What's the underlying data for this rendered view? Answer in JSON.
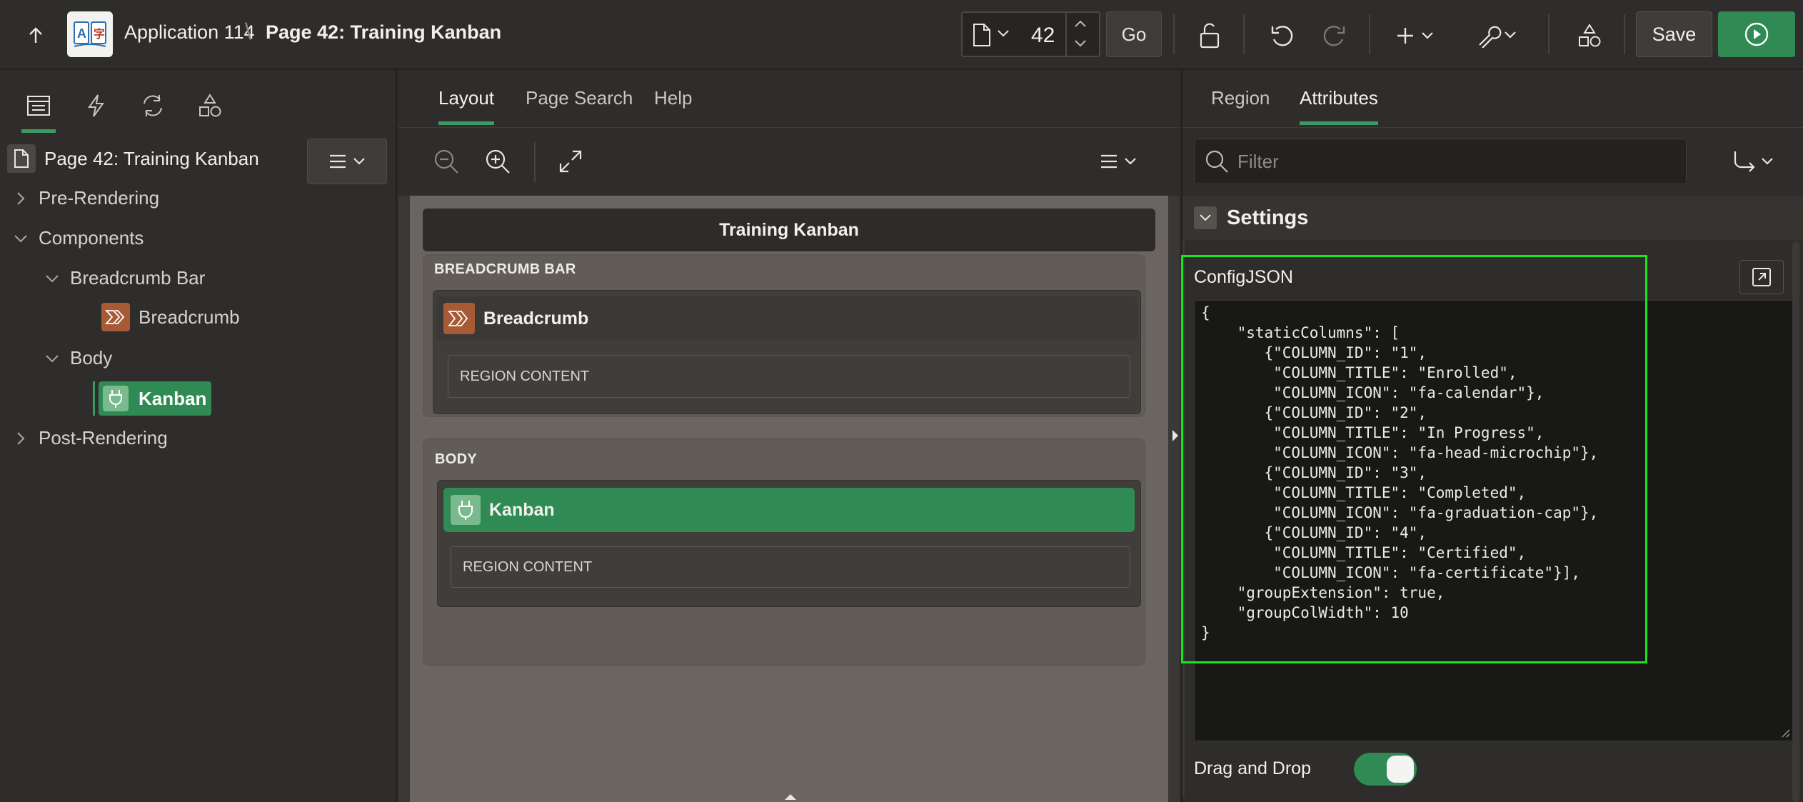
{
  "topbar": {
    "app_name": "Application 114",
    "separator": "\\",
    "page_title": "Page 42: Training Kanban",
    "page_number": "42",
    "go_label": "Go",
    "save_label": "Save",
    "icons": [
      "arrow-up-icon",
      "app-logo-icon",
      "page-icon",
      "chevron-down-icon",
      "lock-icon",
      "undo-icon",
      "redo-icon",
      "plus-icon",
      "wrench-icon",
      "shapes-icon",
      "run-icon"
    ]
  },
  "left": {
    "tabs": [
      "rendering-tab",
      "dynamic-actions-tab",
      "processing-tab",
      "shared-components-tab"
    ],
    "tree": {
      "root": "Page 42: Training Kanban",
      "pre_rendering": "Pre-Rendering",
      "components": "Components",
      "breadcrumb_bar": "Breadcrumb Bar",
      "breadcrumb": "Breadcrumb",
      "body": "Body",
      "kanban": "Kanban",
      "post_rendering": "Post-Rendering"
    }
  },
  "center": {
    "tabs": {
      "layout": "Layout",
      "page_search": "Page Search",
      "help": "Help"
    },
    "region_title": "Training Kanban",
    "breadcrumb_bar_label": "BREADCRUMB BAR",
    "breadcrumb_comp": "Breadcrumb",
    "region_content_1": "REGION CONTENT",
    "body_label": "BODY",
    "kanban_comp": "Kanban",
    "region_content_2": "REGION CONTENT"
  },
  "right": {
    "tabs": {
      "region": "Region",
      "attributes": "Attributes"
    },
    "filter_placeholder": "Filter",
    "settings_title": "Settings",
    "config_label": "ConfigJSON",
    "config_json": "{\n    \"staticColumns\": [\n       {\"COLUMN_ID\": \"1\",\n        \"COLUMN_TITLE\": \"Enrolled\",\n        \"COLUMN_ICON\": \"fa-calendar\"},\n       {\"COLUMN_ID\": \"2\",\n        \"COLUMN_TITLE\": \"In Progress\",\n        \"COLUMN_ICON\": \"fa-head-microchip\"},\n       {\"COLUMN_ID\": \"3\",\n        \"COLUMN_TITLE\": \"Completed\",\n        \"COLUMN_ICON\": \"fa-graduation-cap\"},\n       {\"COLUMN_ID\": \"4\",\n        \"COLUMN_TITLE\": \"Certified\",\n        \"COLUMN_ICON\": \"fa-certificate\"}],\n    \"groupExtension\": true,\n    \"groupColWidth\": 10\n}",
    "drag_drop_label": "Drag and Drop",
    "drag_drop_on": true
  },
  "colors": {
    "accent_green": "#2f8a54",
    "highlight_box": "#19e619",
    "breadcrumb_icon": "#a65a36"
  }
}
